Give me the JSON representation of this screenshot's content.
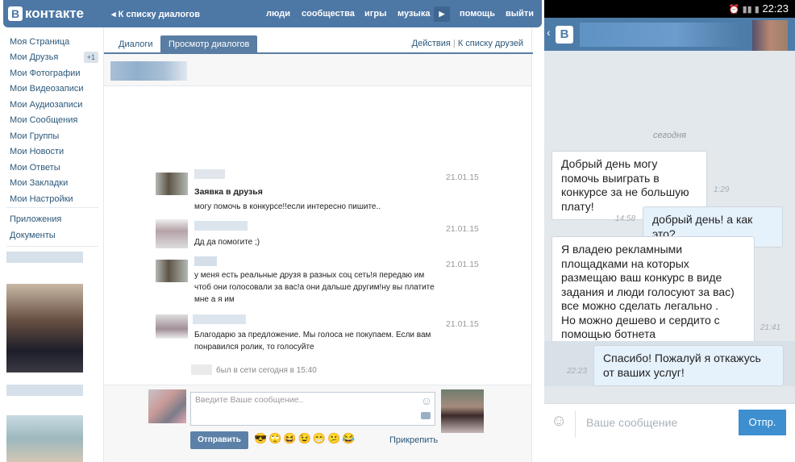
{
  "header": {
    "logo": "ВКонтакте",
    "logo_letter": "В",
    "logo_text": "контакте",
    "back": "◂ К списку диалогов",
    "nav": [
      "люди",
      "сообщества",
      "игры",
      "музыка",
      "помощь",
      "выйти"
    ]
  },
  "sidebar": {
    "items": [
      "Моя Страница",
      "Мои Друзья",
      "Мои Фотографии",
      "Мои Видеозаписи",
      "Мои Аудиозаписи",
      "Мои Сообщения",
      "Мои Группы",
      "Мои Новости",
      "Мои Ответы",
      "Мои Закладки",
      "Мои Настройки"
    ],
    "friends_badge": "+1",
    "extra": [
      "Приложения",
      "Документы"
    ]
  },
  "main": {
    "tabs": [
      "Диалоги",
      "Просмотр диалогов"
    ],
    "actions": "Действия",
    "friends_link": "К списку друзей",
    "separator": "|",
    "messages": [
      {
        "title": "Заявка в друзья",
        "text": "могу помочь в конкурсе!!если интересно пишите..",
        "date": "21.01.15"
      },
      {
        "text": "Дд да помогите ;)",
        "date": "21.01.15"
      },
      {
        "text": "у меня есть реальные друзя в разных соц сеть!я передаю им чтоб они голосовали за вас!а они дальше другим!ну вы платите мне а я им",
        "date": "21.01.15"
      },
      {
        "text": "Благодарю за предложение. Мы голоса не покупаем. Если вам понравился ролик, то голосуйте",
        "date": "21.01.15"
      }
    ],
    "last_seen": "был в сети сегодня в 15:40",
    "input_placeholder": "Введите Ваше сообщение..",
    "send": "Отправить",
    "attach": "Прикрепить",
    "emojis": [
      "😎",
      "🙄",
      "😆",
      "😉",
      "😁",
      "😕",
      "😂"
    ]
  },
  "phone": {
    "status_time": "22:23",
    "app_letter": "В",
    "day": "сегодня",
    "bubbles": [
      {
        "text": "Добрый день могу помочь выиграть в конкурсе за не большую плату!",
        "time": "1:29"
      },
      {
        "text": "добрый день! а как это?",
        "time": "14:58"
      },
      {
        "text": "Я владею рекламными площадками на которых размещаю ваш конкурс в виде задания и люди голосуют за вас) все можно сделать легально .\nНо можно дешево и сердито с помощью ботнета",
        "time": "21:41"
      },
      {
        "text": "Спасибо! Пожалуй я откажусь от ваших услуг!",
        "time": "22:23"
      }
    ],
    "input_placeholder": "Ваше сообщение",
    "send": "Отпр."
  },
  "colors": {
    "vk_blue": "#4d77a5",
    "link": "#2b587a",
    "phone_bg": "#e3e8ed",
    "out_bubble": "#e5f1fb",
    "send_btn": "#3d8fd0"
  }
}
